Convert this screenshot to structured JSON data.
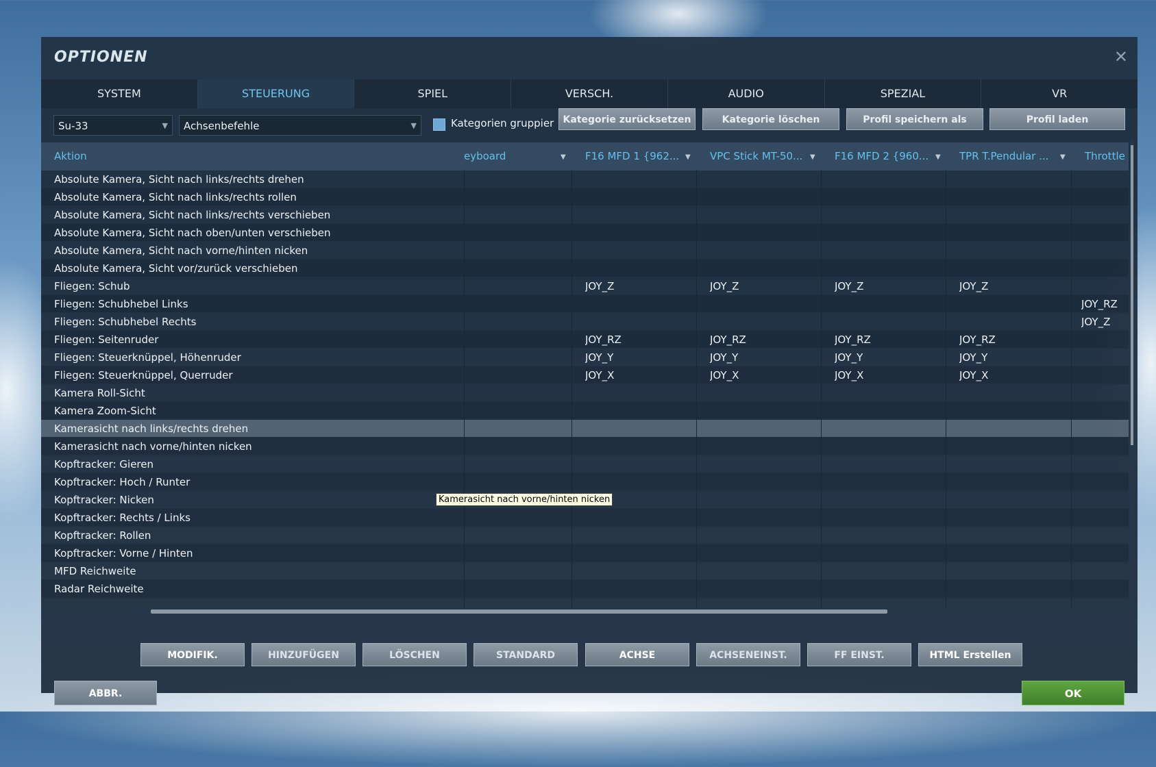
{
  "window": {
    "title": "OPTIONEN",
    "close_symbol": "✕"
  },
  "tabs": [
    {
      "label": "SYSTEM",
      "active": false
    },
    {
      "label": "STEUERUNG",
      "active": true
    },
    {
      "label": "SPIEL",
      "active": false
    },
    {
      "label": "VERSCH.",
      "active": false
    },
    {
      "label": "AUDIO",
      "active": false
    },
    {
      "label": "SPEZIAL",
      "active": false
    },
    {
      "label": "VR",
      "active": false
    }
  ],
  "toolbar": {
    "aircraft_value": "Su-33",
    "category_value": "Achsenbefehle",
    "group_checkbox_label": "Kategorien gruppier",
    "reset_category": "Kategorie zurücksetzen",
    "delete_category": "Kategorie löschen",
    "save_profile": "Profil speichern als",
    "load_profile": "Profil laden"
  },
  "grid": {
    "columns": [
      "Aktion",
      "eyboard",
      "F16 MFD 1 {962...",
      "VPC Stick MT-50...",
      "F16 MFD 2 {960...",
      "TPR T.Pendular ...",
      "Throttle"
    ],
    "rows": [
      {
        "action": "Absolute Kamera, Sicht nach links/rechts drehen",
        "cells": [
          "",
          "",
          "",
          "",
          "",
          ""
        ]
      },
      {
        "action": "Absolute Kamera, Sicht nach links/rechts rollen",
        "cells": [
          "",
          "",
          "",
          "",
          "",
          ""
        ]
      },
      {
        "action": "Absolute Kamera, Sicht nach links/rechts verschieben",
        "cells": [
          "",
          "",
          "",
          "",
          "",
          ""
        ]
      },
      {
        "action": "Absolute Kamera, Sicht nach oben/unten verschieben",
        "cells": [
          "",
          "",
          "",
          "",
          "",
          ""
        ]
      },
      {
        "action": "Absolute Kamera, Sicht nach vorne/hinten nicken",
        "cells": [
          "",
          "",
          "",
          "",
          "",
          ""
        ]
      },
      {
        "action": "Absolute Kamera, Sicht vor/zurück verschieben",
        "cells": [
          "",
          "",
          "",
          "",
          "",
          ""
        ]
      },
      {
        "action": "Fliegen: Schub",
        "cells": [
          "",
          "JOY_Z",
          "JOY_Z",
          "JOY_Z",
          "JOY_Z",
          ""
        ]
      },
      {
        "action": "Fliegen: Schubhebel Links",
        "cells": [
          "",
          "",
          "",
          "",
          "",
          "JOY_RZ"
        ]
      },
      {
        "action": "Fliegen: Schubhebel Rechts",
        "cells": [
          "",
          "",
          "",
          "",
          "",
          "JOY_Z"
        ]
      },
      {
        "action": "Fliegen: Seitenruder",
        "cells": [
          "",
          "JOY_RZ",
          "JOY_RZ",
          "JOY_RZ",
          "JOY_RZ",
          ""
        ]
      },
      {
        "action": "Fliegen: Steuerknüppel, Höhenruder",
        "cells": [
          "",
          "JOY_Y",
          "JOY_Y",
          "JOY_Y",
          "JOY_Y",
          ""
        ]
      },
      {
        "action": "Fliegen: Steuerknüppel, Querruder",
        "cells": [
          "",
          "JOY_X",
          "JOY_X",
          "JOY_X",
          "JOY_X",
          ""
        ]
      },
      {
        "action": "Kamera Roll-Sicht",
        "cells": [
          "",
          "",
          "",
          "",
          "",
          ""
        ]
      },
      {
        "action": "Kamera Zoom-Sicht",
        "cells": [
          "",
          "",
          "",
          "",
          "",
          ""
        ]
      },
      {
        "action": "Kamerasicht nach links/rechts drehen",
        "cells": [
          "",
          "",
          "",
          "",
          "",
          ""
        ],
        "selected": true
      },
      {
        "action": "Kamerasicht nach vorne/hinten nicken",
        "cells": [
          "",
          "",
          "",
          "",
          "",
          ""
        ]
      },
      {
        "action": "Kopftracker: Gieren",
        "cells": [
          "",
          "",
          "",
          "",
          "",
          ""
        ]
      },
      {
        "action": "Kopftracker: Hoch / Runter",
        "cells": [
          "",
          "",
          "",
          "",
          "",
          ""
        ]
      },
      {
        "action": "Kopftracker: Nicken",
        "cells": [
          "",
          "",
          "",
          "",
          "",
          ""
        ]
      },
      {
        "action": "Kopftracker: Rechts / Links",
        "cells": [
          "",
          "",
          "",
          "",
          "",
          ""
        ]
      },
      {
        "action": "Kopftracker: Rollen",
        "cells": [
          "",
          "",
          "",
          "",
          "",
          ""
        ]
      },
      {
        "action": "Kopftracker: Vorne / Hinten",
        "cells": [
          "",
          "",
          "",
          "",
          "",
          ""
        ]
      },
      {
        "action": "MFD Reichweite",
        "cells": [
          "",
          "",
          "",
          "",
          "",
          ""
        ]
      },
      {
        "action": "Radar Reichweite",
        "cells": [
          "",
          "",
          "",
          "",
          "",
          ""
        ]
      }
    ]
  },
  "tooltip": "Kamerasicht nach vorne/hinten nicken",
  "footer": {
    "buttons": [
      "MODIFIK.",
      "HINZUFÜGEN",
      "LÖSCHEN",
      "STANDARD",
      "ACHSE",
      "ACHSENEINST.",
      "FF EINST.",
      "HTML Erstellen"
    ],
    "cancel": "ABBR.",
    "ok": "OK"
  },
  "colors": {
    "accent": "#64c0ec",
    "ok_green": "#4f9236",
    "panel": "#1e2d3e"
  }
}
